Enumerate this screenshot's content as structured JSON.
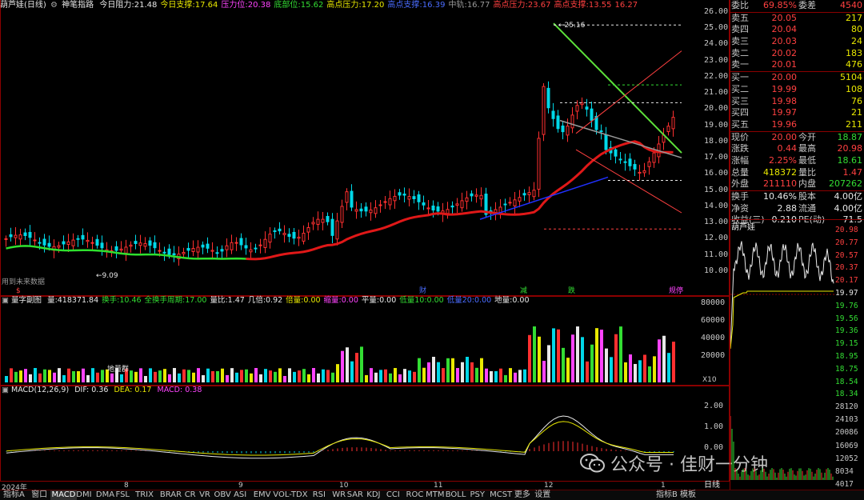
{
  "header": {
    "title": "葫芦娃(日线)",
    "indicator_name": "神笔指路",
    "items": [
      {
        "label": "今日阻力:",
        "value": "21.48",
        "color": "#e8e8e8"
      },
      {
        "label": "今日支撑:",
        "value": "17.64",
        "color": "#e8e800"
      },
      {
        "label": "压力位:",
        "value": "20.38",
        "color": "#ff44ff"
      },
      {
        "label": "底部位:",
        "value": "15.62",
        "color": "#33dd33"
      },
      {
        "label": "高点压力:",
        "value": "17.20",
        "color": "#e8e800"
      },
      {
        "label": "高点支撑:",
        "value": "16.39",
        "color": "#4a6cff"
      },
      {
        "label": "中轨:",
        "value": "16.77",
        "color": "#9a9a9a"
      },
      {
        "label": "高点压力:",
        "value": "23.67",
        "color": "#ff4040"
      },
      {
        "label": "高点支撑:",
        "value": "13.55",
        "color": "#ff4040"
      },
      {
        "label": "",
        "value": "16.27",
        "color": "#ff4040"
      }
    ]
  },
  "price_axis": [
    "26.00",
    "25.00",
    "24.00",
    "23.00",
    "22.00",
    "21.00",
    "20.00",
    "19.00",
    "18.00",
    "17.00",
    "16.00",
    "15.00",
    "14.00",
    "13.00",
    "12.00",
    "11.00",
    "10.00"
  ],
  "price_annotations": {
    "high_label": "25.16",
    "low_label": "9.09",
    "no_data": "用到未来数据"
  },
  "event_marks": [
    {
      "text": "$",
      "color": "#ff4040"
    },
    {
      "text": "财",
      "color": "#4a6cff"
    },
    {
      "text": "减",
      "color": "#33dd33"
    },
    {
      "text": "跌",
      "color": "#33dd33"
    },
    {
      "text": "规停",
      "color": "#ff44ff"
    }
  ],
  "volume_header": {
    "name": "量字副图",
    "items": [
      {
        "label": "量:",
        "value": "418371.84",
        "color": "#e8e8e8"
      },
      {
        "label": "换手:",
        "value": "10.46",
        "color": "#33dd33"
      },
      {
        "label": "全换手周期:",
        "value": "17.00",
        "color": "#33dd33"
      },
      {
        "label": "量比:",
        "value": "1.47",
        "color": "#e8e8e8"
      },
      {
        "label": "几倍:",
        "value": "0.92",
        "color": "#e8e8e8"
      },
      {
        "label": "倍量:",
        "value": "0.00",
        "color": "#e8e800"
      },
      {
        "label": "缩量:",
        "value": "0.00",
        "color": "#ff44ff"
      },
      {
        "label": "平量:",
        "value": "0.00",
        "color": "#e8e8e8"
      },
      {
        "label": "低量10:",
        "value": "0.00",
        "color": "#33dd33"
      },
      {
        "label": "低量20:",
        "value": "0.00",
        "color": "#4a6cff"
      },
      {
        "label": "地量:",
        "value": "0.00",
        "color": "#e8e8e8"
      }
    ],
    "axis": [
      "80000",
      "60000",
      "40000",
      "20000"
    ],
    "unit": "X10",
    "group_label": "地量群"
  },
  "macd_header": {
    "name": "MACD(12,26,9)",
    "dif": "DIF: 0.36",
    "dea": "DEA: 0.17",
    "macd": "MACD: 0.38",
    "axis": [
      "2.00",
      "1.00",
      "0.00"
    ]
  },
  "date_axis": [
    "2024年",
    "8",
    "9",
    "10",
    "11",
    "12",
    "1"
  ],
  "quote": {
    "weibi": {
      "label": "委比",
      "value": "69.85%",
      "label2": "委差",
      "value2": "4540"
    },
    "sell": [
      {
        "label": "卖五",
        "price": "20.05",
        "vol": "217"
      },
      {
        "label": "卖四",
        "price": "20.04",
        "vol": "80"
      },
      {
        "label": "卖三",
        "price": "20.03",
        "vol": "24"
      },
      {
        "label": "卖二",
        "price": "20.02",
        "vol": "183"
      },
      {
        "label": "卖一",
        "price": "20.01",
        "vol": "476"
      }
    ],
    "buy": [
      {
        "label": "买一",
        "price": "20.00",
        "vol": "5104"
      },
      {
        "label": "买二",
        "price": "19.99",
        "vol": "108"
      },
      {
        "label": "买三",
        "price": "19.98",
        "vol": "76"
      },
      {
        "label": "买四",
        "price": "19.97",
        "vol": "21"
      },
      {
        "label": "买五",
        "price": "19.96",
        "vol": "211"
      }
    ],
    "stats": [
      {
        "l1": "现价",
        "v1": "20.00",
        "c1": "#ff4040",
        "l2": "今开",
        "v2": "18.87",
        "c2": "#33dd33"
      },
      {
        "l1": "涨跌",
        "v1": "0.44",
        "c1": "#ff4040",
        "l2": "最高",
        "v2": "20.98",
        "c2": "#ff4040"
      },
      {
        "l1": "涨幅",
        "v1": "2.25%",
        "c1": "#ff4040",
        "l2": "最低",
        "v2": "18.61",
        "c2": "#33dd33"
      },
      {
        "l1": "总量",
        "v1": "418372",
        "c1": "#e8e800",
        "l2": "量比",
        "v2": "1.47",
        "c2": "#ff4040"
      },
      {
        "l1": "外盘",
        "v1": "211110",
        "c1": "#ff4040",
        "l2": "内盘",
        "v2": "207262",
        "c2": "#33dd33"
      }
    ],
    "fundamentals": [
      {
        "l1": "换手",
        "v1": "10.46%",
        "l2": "股本",
        "v2": "4.00亿"
      },
      {
        "l1": "净资",
        "v1": "2.88",
        "l2": "流通",
        "v2": "4.00亿"
      },
      {
        "l1": "收益(三)",
        "v1": "0.210",
        "l2": "PE(动)",
        "v2": "71.5"
      }
    ]
  },
  "intraday": {
    "name": "葫芦娃",
    "axis": [
      "20.98",
      "20.77",
      "20.57",
      "20.37",
      "20.17",
      "19.97",
      "19.76",
      "19.56",
      "19.36",
      "19.15",
      "18.95",
      "18.75",
      "18.54",
      "18.34"
    ],
    "vol_axis": [
      "28120",
      "24103",
      "20086",
      "16069",
      "12052",
      "8034",
      "4017"
    ]
  },
  "bottom_tabs": [
    "指标A",
    "窗口",
    "MACD",
    "DMI",
    "DMA",
    "FSL",
    "TRIX",
    "BRAR",
    "CR",
    "VR",
    "OBV",
    "ASI",
    "EMV",
    "VOL-TDX",
    "RSI",
    "WR",
    "SAR",
    "KDJ",
    "CCI",
    "ROC",
    "MTM",
    "BOLL",
    "PSY",
    "MCST",
    "更多",
    "设置"
  ],
  "right_tabs": [
    "指标B",
    "模板"
  ],
  "right_panel_tab": "日线",
  "watermark": "公众号 · 佳财一分钟",
  "colors": {
    "up": "#ff3030",
    "down": "#00d8e8",
    "bg": "#000000",
    "grid": "#7a0000"
  }
}
